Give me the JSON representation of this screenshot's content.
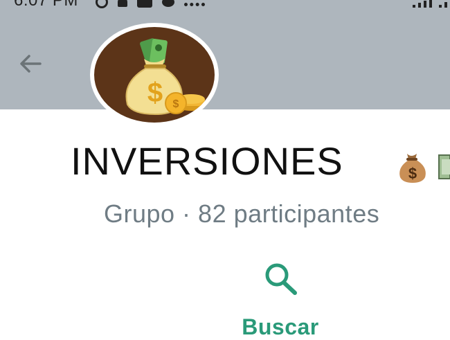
{
  "status_bar": {
    "time": "6:07 PM"
  },
  "header": {
    "back_icon": "arrow-left-icon",
    "avatar_icon": "money-bag-icon"
  },
  "group": {
    "title": "INVERSIONES",
    "title_emoji_icon": "money-bag-emoji",
    "subtitle": "Grupo · 82 participantes"
  },
  "actions": {
    "search_label": "Buscar",
    "search_icon": "search-icon"
  },
  "colors": {
    "header_bg": "#aeb6bd",
    "accent": "#2a9a79",
    "avatar_bg": "#5c3418",
    "subtitle": "#6f7c84"
  }
}
